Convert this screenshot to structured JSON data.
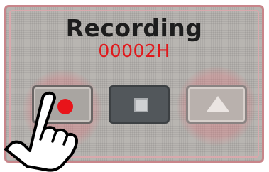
{
  "screen": {
    "title": "Recording",
    "counter": "00002H"
  },
  "buttons": {
    "record": {
      "icon": "record-dot-icon",
      "color": "#e8141a"
    },
    "stop": {
      "icon": "stop-square-icon"
    },
    "eject": {
      "icon": "eject-triangle-icon"
    }
  },
  "overlay": {
    "pointer": "pointing-hand-icon",
    "highlight_color": "#e86e78"
  }
}
